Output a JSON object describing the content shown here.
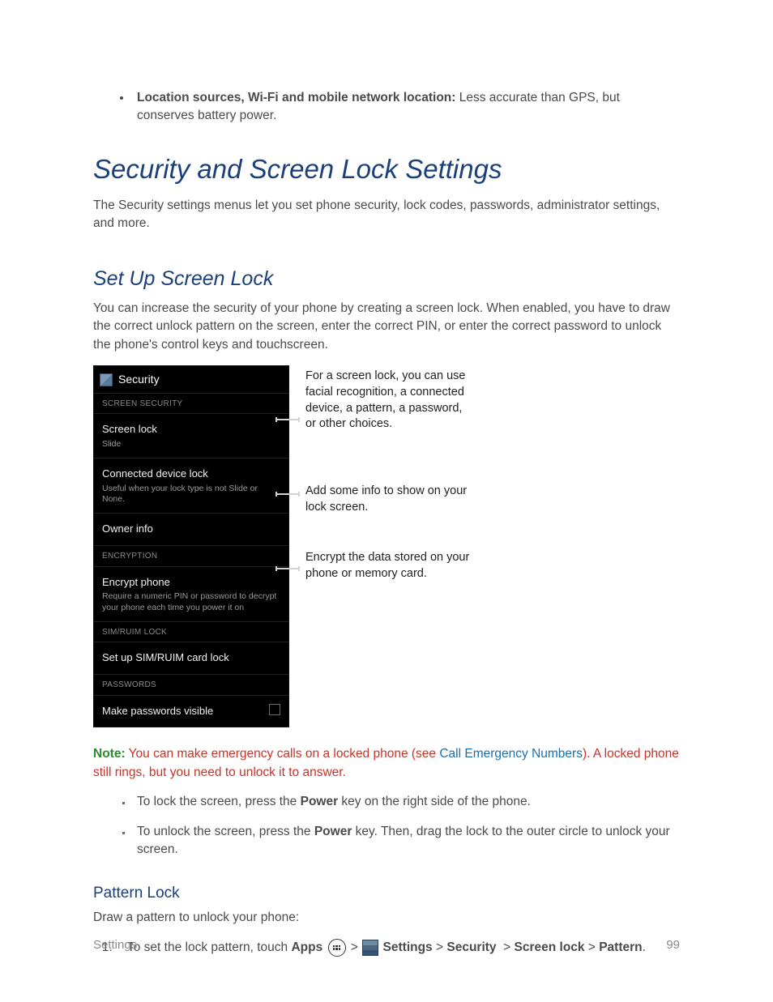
{
  "bullet0": {
    "bold": "Location sources, Wi-Fi and mobile network location:",
    "rest": " Less accurate than GPS, but conserves battery power."
  },
  "h1": "Security and Screen Lock Settings",
  "intro1": "The Security settings menus let you set phone security, lock codes, passwords, administrator settings, and more.",
  "h2": "Set Up Screen Lock",
  "intro2": "You can increase the security of your phone by creating a screen lock. When enabled, you have to draw the correct unlock pattern on the screen, enter the correct PIN, or enter the correct password to unlock the phone's control keys and touchscreen.",
  "phone": {
    "title": "Security",
    "sect1": "SCREEN SECURITY",
    "row_screenlock": {
      "title": "Screen lock",
      "sub": "Slide"
    },
    "row_connected": {
      "title": "Connected device lock",
      "sub": "Useful when your lock type is not Slide or None."
    },
    "row_owner": {
      "title": "Owner info"
    },
    "sect2": "ENCRYPTION",
    "row_encrypt": {
      "title": "Encrypt phone",
      "sub": "Require a numeric PIN or password to decrypt your phone each time you power it on"
    },
    "sect3": "SIM/RUIM LOCK",
    "row_sim": {
      "title": "Set up SIM/RUIM card lock"
    },
    "sect4": "PASSWORDS",
    "row_pwvis": {
      "title": "Make passwords visible"
    }
  },
  "callouts": {
    "c1": "For a screen lock, you can use facial recognition, a connected device, a pattern, a password, or other choices.",
    "c2": "Add some info to show on your lock screen.",
    "c3": "Encrypt the data stored on your phone or memory card."
  },
  "note": {
    "label": "Note:",
    "before": " You can make emergency calls on a locked phone (see ",
    "link": "Call Emergency Numbers",
    "after": "). A locked phone still rings, but you need to unlock it to answer."
  },
  "sq1": {
    "pre": "To lock the screen, press the ",
    "bold": "Power",
    "post": " key on the right side of the phone."
  },
  "sq2": {
    "pre": "To unlock the screen, press the ",
    "bold": "Power",
    "post": " key. Then, drag the lock to the outer circle to unlock your screen."
  },
  "h3": "Pattern Lock",
  "pattern_intro": "Draw a pattern to unlock your phone:",
  "step1": {
    "pre": "To set the lock pattern, touch ",
    "apps": "Apps",
    "settings": "Settings",
    "security": "Security",
    "screenlock": "Screen lock",
    "pattern": "Pattern"
  },
  "footer": {
    "left": "Settings",
    "right": "99"
  }
}
